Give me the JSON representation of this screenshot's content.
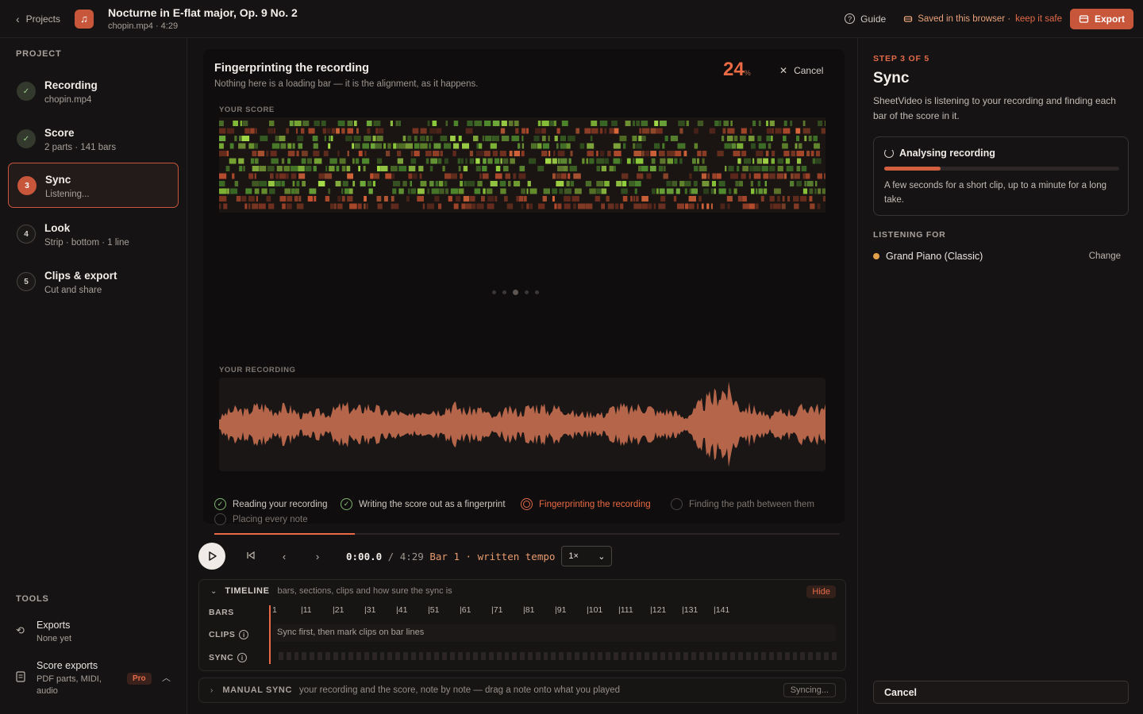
{
  "header": {
    "back_label": "Projects",
    "title": "Nocturne in E-flat major, Op. 9 No. 2",
    "subtitle": "chopin.mp4 · 4:29",
    "guide_label": "Guide",
    "saved_label": "Saved in this browser ·",
    "keep_safe_label": "keep it safe",
    "export_label": "Export"
  },
  "sidebar": {
    "section_label": "PROJECT",
    "steps": [
      {
        "num": "✓",
        "label": "Recording",
        "sub": "chopin.mp4",
        "state": "done"
      },
      {
        "num": "✓",
        "label": "Score",
        "sub": "2 parts · 141 bars",
        "state": "done"
      },
      {
        "num": "3",
        "label": "Sync",
        "sub": "Listening...",
        "state": "current"
      },
      {
        "num": "4",
        "label": "Look",
        "sub": "Strip · bottom · 1 line",
        "state": "todo"
      },
      {
        "num": "5",
        "label": "Clips & export",
        "sub": "Cut and share",
        "state": "todo"
      }
    ],
    "tools_label": "TOOLS",
    "tools": [
      {
        "label": "Exports",
        "sub": "None yet"
      },
      {
        "label": "Score exports",
        "sub": "PDF parts, MIDI, audio",
        "badge": "Pro"
      }
    ]
  },
  "main": {
    "title": "Fingerprinting the recording",
    "subtitle": "Nothing here is a loading bar — it is the alignment, as it happens.",
    "percent": "24",
    "percent_unit": "%",
    "cancel_label": "Cancel",
    "score_label": "YOUR SCORE",
    "recording_label": "YOUR RECORDING",
    "progress_fraction": 0.224,
    "checklist": [
      {
        "label": "Reading your recording",
        "state": "done"
      },
      {
        "label": "Writing the score out as a fingerprint",
        "state": "done"
      },
      {
        "label": "Fingerprinting the recording",
        "state": "current"
      },
      {
        "label": "Finding the path between them",
        "state": "todo"
      },
      {
        "label": "Placing every note",
        "state": "todo"
      }
    ]
  },
  "transport": {
    "time_current": "0:00.0",
    "time_sep": " / ",
    "time_total": "4:29",
    "bar_text": "Bar 1 · written tempo",
    "speed": "1×"
  },
  "timeline": {
    "title": "TIMELINE",
    "desc": "bars, sections, clips and how sure the sync is",
    "hide_label": "Hide",
    "rows": {
      "bars": "BARS",
      "clips": "CLIPS",
      "sync": "SYNC"
    },
    "bar_numbers": [
      "1",
      "|11",
      "|21",
      "|31",
      "|41",
      "|51",
      "|61",
      "|71",
      "|81",
      "|91",
      "|101",
      "|111",
      "|121",
      "|131",
      "|141"
    ],
    "clips_hint": "Sync first, then mark clips on bar lines"
  },
  "manual_sync": {
    "title": "MANUAL SYNC",
    "desc": "your recording and the score, note by note — drag a note onto what you played",
    "status": "Syncing..."
  },
  "right_panel": {
    "step_of": "STEP 3 OF 5",
    "title": "Sync",
    "desc": "SheetVideo is listening to your recording and finding each bar of the score in it.",
    "analysing_title": "Analysing recording",
    "analysing_progress": 0.24,
    "analysing_desc": "A few seconds for a short clip, up to a minute for a long take.",
    "listening_label": "LISTENING FOR",
    "instrument": "Grand Piano (Classic)",
    "change_label": "Change",
    "cancel_label": "Cancel"
  },
  "colors": {
    "accent": "#c7563b",
    "accent_text": "#ea6a45",
    "done_green": "#8fcb7e",
    "instrument_dot": "#e3a04a"
  },
  "icons": [
    "chevron-left-icon",
    "music-note-icon",
    "help-circle-icon",
    "database-icon",
    "export-icon",
    "check-icon",
    "close-icon",
    "play-icon",
    "skip-back-icon",
    "chevron-right-icon",
    "history-icon",
    "document-icon",
    "spinner-icon",
    "info-icon"
  ]
}
